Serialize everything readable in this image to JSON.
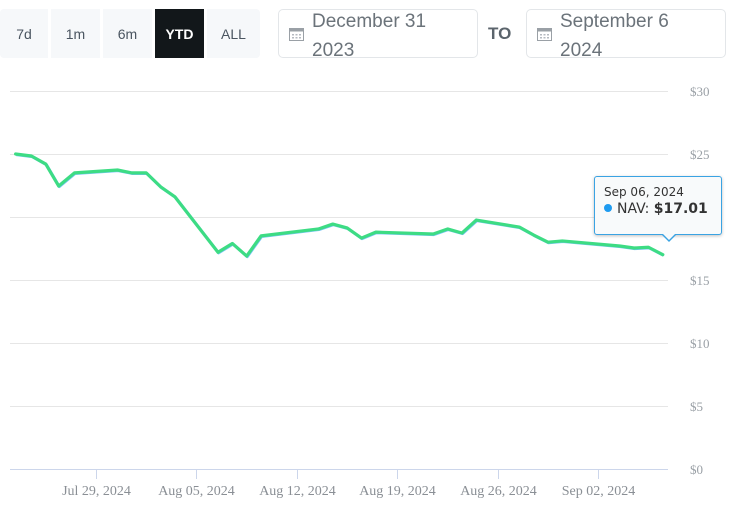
{
  "range_buttons": [
    {
      "label": "7d",
      "active": false
    },
    {
      "label": "1m",
      "active": false
    },
    {
      "label": "6m",
      "active": false
    },
    {
      "label": "YTD",
      "active": true
    },
    {
      "label": "ALL",
      "active": false
    }
  ],
  "date_range": {
    "from": "December 31\n2023",
    "to_label": "TO",
    "to": "September 6\n2024",
    "icon": "calendar-icon"
  },
  "tooltip": {
    "date": "Sep 06, 2024",
    "series_label": "NAV:",
    "value": "$17.01",
    "dot_color": "#1e9bf0"
  },
  "chart_data": {
    "type": "line",
    "title": "",
    "xlabel": "",
    "ylabel": "",
    "line_color": "#3ddc84",
    "grid": true,
    "y_axis_position": "right",
    "ylim": [
      0,
      30
    ],
    "y_ticks": [
      0,
      5,
      10,
      15,
      20,
      25,
      30
    ],
    "y_tick_labels": [
      "$0",
      "$5",
      "$10",
      "$15",
      "$20",
      "$25",
      "$30"
    ],
    "x_tick_labels": [
      "Jul 29, 2024",
      "Aug 05, 2024",
      "Aug 12, 2024",
      "Aug 19, 2024",
      "Aug 26, 2024",
      "Sep 02, 2024"
    ],
    "x_tick_days": [
      0,
      7,
      14,
      21,
      28,
      35
    ],
    "xlim_days": [
      -6,
      40.5
    ],
    "series": [
      {
        "name": "NAV",
        "points": [
          {
            "date": "Jul 23, 2024",
            "day": -5.6,
            "value": 25.0
          },
          {
            "date": "Jul 24, 2024",
            "day": -4.5,
            "value": 24.84
          },
          {
            "date": "Jul 25, 2024",
            "day": -3.5,
            "value": 24.2
          },
          {
            "date": "Jul 26, 2024",
            "day": -2.6,
            "value": 22.46
          },
          {
            "date": "Jul 27, 2024",
            "day": -1.5,
            "value": 23.5
          },
          {
            "date": "Jul 30, 2024",
            "day": 1.5,
            "value": 23.73
          },
          {
            "date": "Jul 31, 2024",
            "day": 2.5,
            "value": 23.5
          },
          {
            "date": "Aug 01, 2024",
            "day": 3.5,
            "value": 23.5
          },
          {
            "date": "Aug 02, 2024",
            "day": 4.5,
            "value": 22.4
          },
          {
            "date": "Aug 03, 2024",
            "day": 5.5,
            "value": 21.6
          },
          {
            "date": "Aug 06, 2024",
            "day": 8.5,
            "value": 17.2
          },
          {
            "date": "Aug 07, 2024",
            "day": 9.5,
            "value": 17.9
          },
          {
            "date": "Aug 08, 2024",
            "day": 10.5,
            "value": 16.9
          },
          {
            "date": "Aug 09, 2024",
            "day": 11.5,
            "value": 18.5
          },
          {
            "date": "Aug 13, 2024",
            "day": 15.5,
            "value": 19.05
          },
          {
            "date": "Aug 14, 2024",
            "day": 16.5,
            "value": 19.44
          },
          {
            "date": "Aug 15, 2024",
            "day": 17.5,
            "value": 19.13
          },
          {
            "date": "Aug 16, 2024",
            "day": 18.5,
            "value": 18.33
          },
          {
            "date": "Aug 17, 2024",
            "day": 19.5,
            "value": 18.8
          },
          {
            "date": "Aug 21, 2024",
            "day": 23.5,
            "value": 18.65
          },
          {
            "date": "Aug 22, 2024",
            "day": 24.5,
            "value": 19.05
          },
          {
            "date": "Aug 23, 2024",
            "day": 25.5,
            "value": 18.73
          },
          {
            "date": "Aug 24, 2024",
            "day": 26.5,
            "value": 19.76
          },
          {
            "date": "Aug 27, 2024",
            "day": 29.5,
            "value": 19.2
          },
          {
            "date": "Aug 28, 2024",
            "day": 30.5,
            "value": 18.57
          },
          {
            "date": "Aug 29, 2024",
            "day": 31.5,
            "value": 18.0
          },
          {
            "date": "Aug 30, 2024",
            "day": 32.5,
            "value": 18.1
          },
          {
            "date": "Sep 03, 2024",
            "day": 36.5,
            "value": 17.7
          },
          {
            "date": "Sep 04, 2024",
            "day": 37.5,
            "value": 17.54
          },
          {
            "date": "Sep 05, 2024",
            "day": 38.5,
            "value": 17.6
          },
          {
            "date": "Sep 06, 2024",
            "day": 39.5,
            "value": 17.01
          }
        ]
      }
    ]
  }
}
